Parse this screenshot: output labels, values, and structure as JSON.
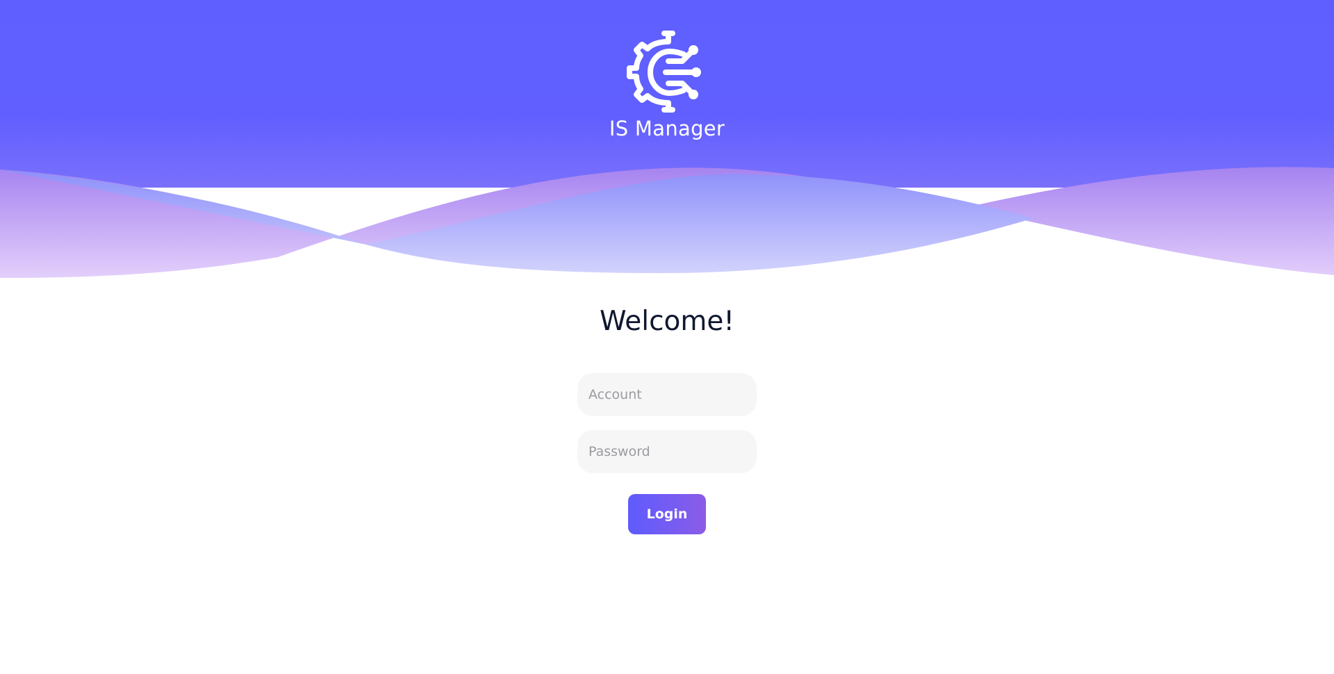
{
  "app": {
    "name": "IS Manager",
    "logo_icon": "gear-circuit-icon"
  },
  "login": {
    "heading": "Welcome!",
    "account_placeholder": "Account",
    "account_value": "",
    "password_placeholder": "Password",
    "password_value": "",
    "submit_label": "Login"
  },
  "colors": {
    "brand": "#5F5FFF",
    "accent": "#8C5BE6",
    "wave_light": "#E2CCFB",
    "field_background": "#F6F6F6",
    "text_dark": "#0F1730"
  }
}
